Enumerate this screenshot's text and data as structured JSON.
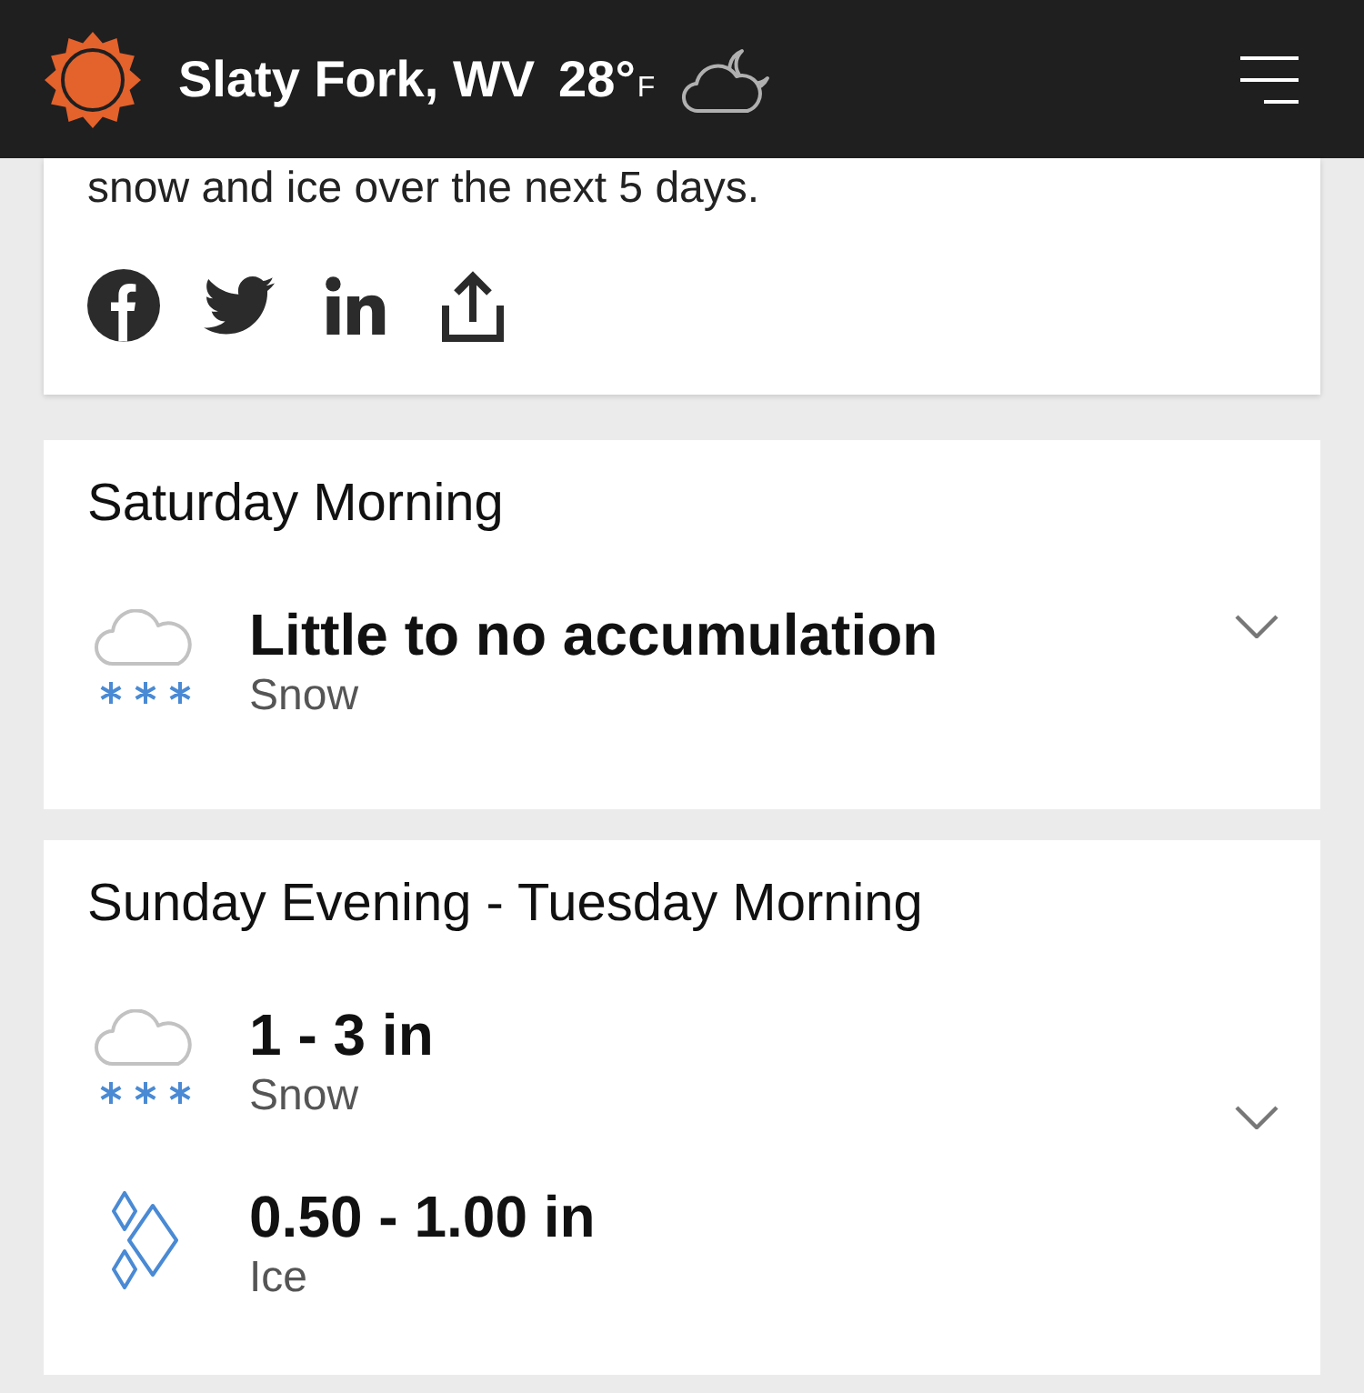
{
  "header": {
    "location": "Slaty Fork, WV",
    "temperature": "28°",
    "unit": "F"
  },
  "summary": {
    "text": "snow and ice over the next 5 days."
  },
  "periods": [
    {
      "title": "Saturday Morning",
      "expanded": false,
      "amounts": [
        {
          "kind": "snow",
          "amount": "Little to no accumulation",
          "precipitation": "Snow"
        }
      ]
    },
    {
      "title": "Sunday Evening - Tuesday Morning",
      "expanded": false,
      "amounts": [
        {
          "kind": "snow",
          "amount": "1 - 3 in",
          "precipitation": "Snow"
        },
        {
          "kind": "ice",
          "amount": "0.50 - 1.00 in",
          "precipitation": "Ice"
        }
      ]
    }
  ]
}
